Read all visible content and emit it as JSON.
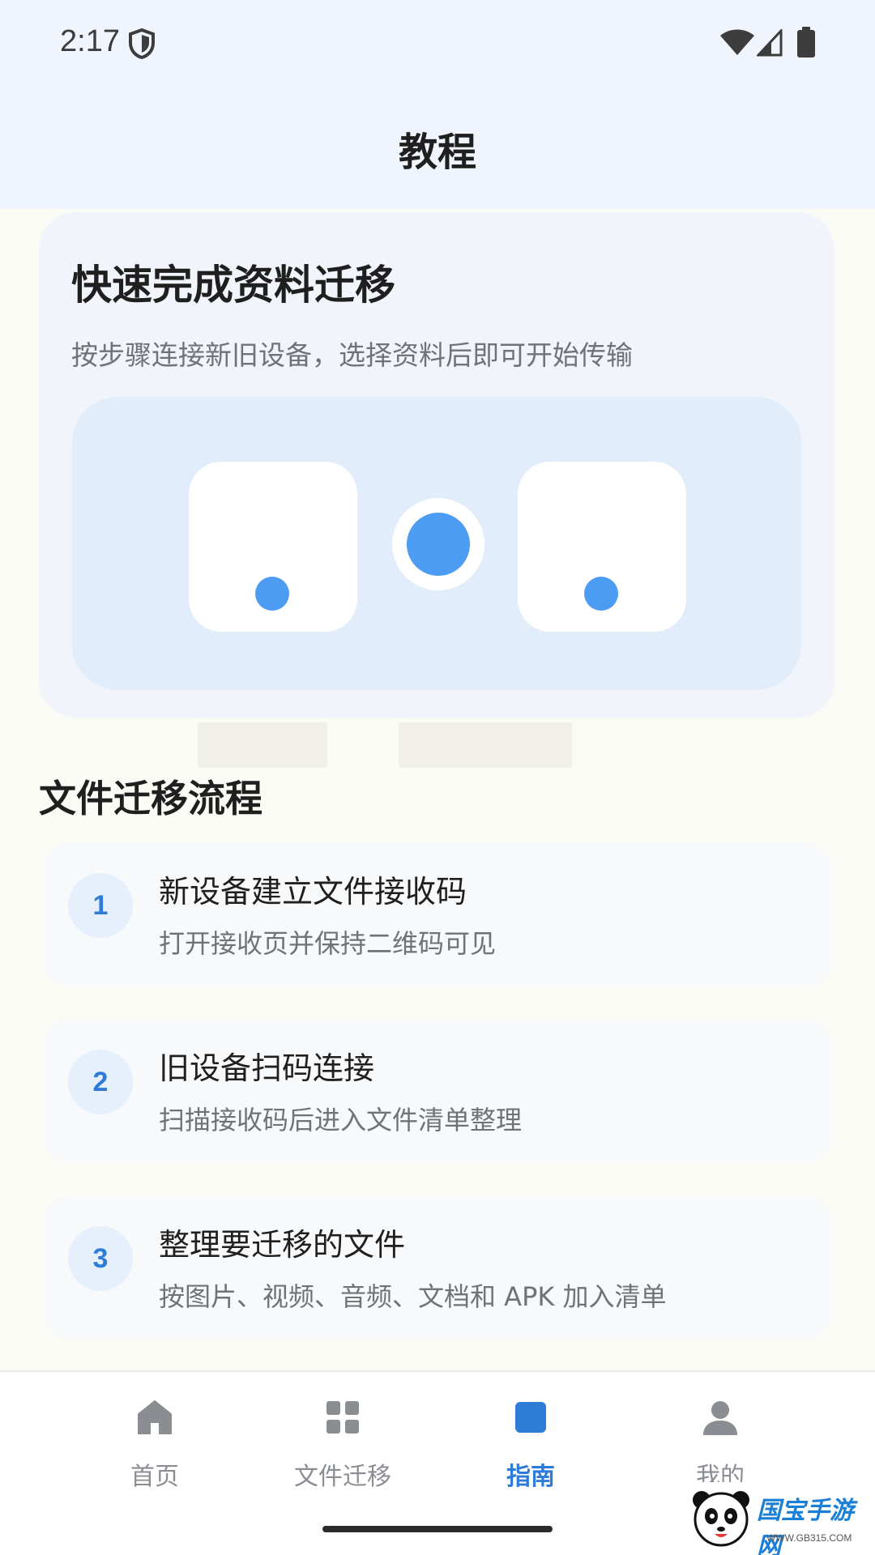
{
  "status_bar": {
    "time": "2:17",
    "icons": [
      "shield-icon",
      "wifi-icon",
      "signal-icon",
      "battery-icon"
    ]
  },
  "header": {
    "title": "教程"
  },
  "hero": {
    "title": "快速完成资料迁移",
    "subtitle": "按步骤连接新旧设备，选择资料后即可开始传输"
  },
  "section": {
    "title": "文件迁移流程"
  },
  "steps": [
    {
      "number": "1",
      "title": "新设备建立文件接收码",
      "desc": "打开接收页并保持二维码可见"
    },
    {
      "number": "2",
      "title": "旧设备扫码连接",
      "desc": "扫描接收码后进入文件清单整理"
    },
    {
      "number": "3",
      "title": "整理要迁移的文件",
      "desc": "按图片、视频、音频、文档和 APK 加入清单"
    }
  ],
  "bottom_nav": {
    "items": [
      {
        "label": "首页",
        "icon": "home-icon",
        "active": false
      },
      {
        "label": "文件迁移",
        "icon": "grid-icon",
        "active": false
      },
      {
        "label": "指南",
        "icon": "guide-icon",
        "active": true
      },
      {
        "label": "我的",
        "icon": "person-icon",
        "active": false
      }
    ]
  },
  "watermark": {
    "text": "国宝手游网",
    "sub": "WWW.GB315.COM"
  },
  "colors": {
    "accent": "#2f7bd8",
    "dot_blue": "#4d9cf3",
    "header_bg": "#f0f5fd",
    "illustration_bg": "#e1edfb"
  }
}
